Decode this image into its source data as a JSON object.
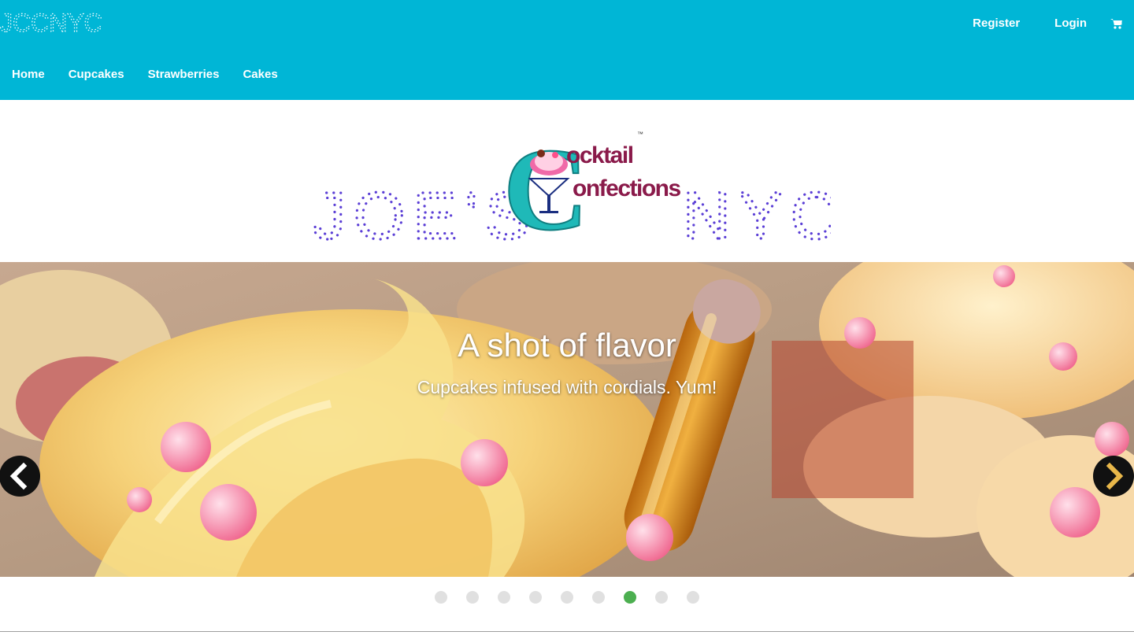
{
  "brand": {
    "text": "JCCNYC"
  },
  "top_links": {
    "register": "Register",
    "login": "Login",
    "cart_icon": "shopping-cart-icon"
  },
  "nav": {
    "items": [
      {
        "label": "Home"
      },
      {
        "label": "Cupcakes"
      },
      {
        "label": "Strawberries"
      },
      {
        "label": "Cakes"
      }
    ]
  },
  "logo": {
    "left_text": "JOE'S",
    "right_text": "NYC",
    "emblem_line1": "ocktail",
    "emblem_line2": "onfections",
    "trademark": "™"
  },
  "carousel": {
    "title": "A shot of flavor",
    "subtitle": "Cupcakes infused with cordials. Yum!",
    "prev_icon": "chevron-left-icon",
    "next_icon": "chevron-right-icon",
    "slide_count": 9,
    "active_index": 6
  },
  "colors": {
    "navbar": "#00b6d6",
    "logo_dots": "#5b3fd6",
    "active_dot": "#4caf50",
    "inactive_dot": "#e0e0e0",
    "emblem_teal": "#1fb9b8",
    "emblem_text": "#8a1a4a"
  }
}
